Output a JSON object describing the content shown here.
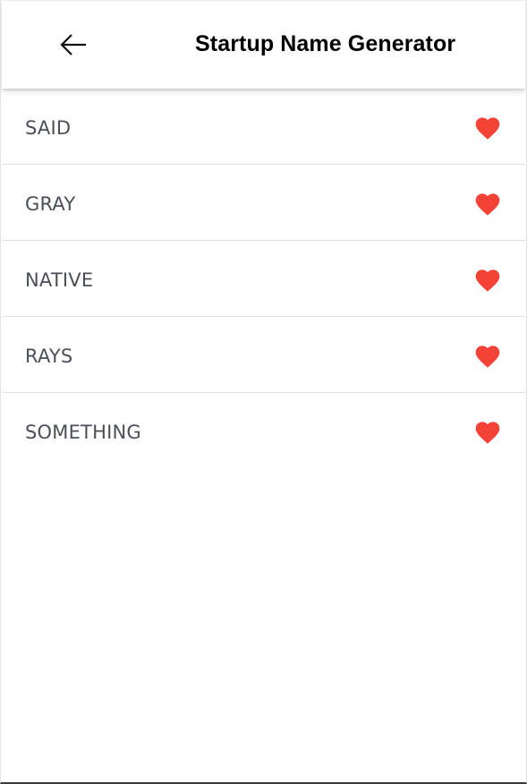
{
  "appbar": {
    "title": "Startup Name Generator",
    "back_icon": "arrow-back-icon"
  },
  "saved_list": {
    "items": [
      {
        "label": "SAID",
        "icon": "heart-filled-icon"
      },
      {
        "label": "GRAY",
        "icon": "heart-filled-icon"
      },
      {
        "label": "NATIVE",
        "icon": "heart-filled-icon"
      },
      {
        "label": "RAYS",
        "icon": "heart-filled-icon"
      },
      {
        "label": "SOMETHING",
        "icon": "heart-filled-icon"
      }
    ]
  },
  "colors": {
    "heart": "#f44336",
    "label_text": "#4a4f57",
    "title_text": "#000000",
    "divider": "#e0e0e0"
  }
}
